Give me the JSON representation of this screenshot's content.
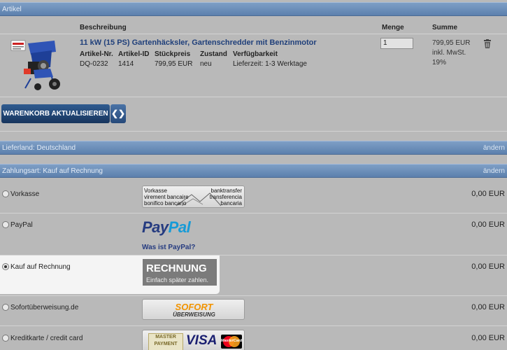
{
  "artikel_bar": {
    "label": "Artikel"
  },
  "table_headers": {
    "beschreibung": "Beschreibung",
    "menge": "Menge",
    "summe": "Summe"
  },
  "product": {
    "title": "11 kW (15 PS) Gartenhäcksler, Gartenschredder mit Benzinmotor",
    "artikel_nr_label": "Artikel-Nr.",
    "artikel_nr": "DQ-0232",
    "artikel_id_label": "Artikel-ID",
    "artikel_id": "1414",
    "stueckpreis_label": "Stückpreis",
    "stueckpreis": "799,95 EUR",
    "zustand_label": "Zustand",
    "zustand": "neu",
    "verfuegbarkeit_label": "Verfügbarkeit",
    "verfuegbarkeit": "Lieferzeit: 1-3 Werktage",
    "quantity": "1",
    "sum_price": "799,95 EUR",
    "sum_tax": "inkl. MwSt.",
    "sum_rate": "19%",
    "icons": {
      "image": "garden-shredder-image",
      "delete": "trash-icon"
    }
  },
  "cart": {
    "update_label": "WARENKORB AKTUALISIEREN",
    "arrow_label": "❮❯"
  },
  "lieferland_bar": {
    "label": "Lieferland: Deutschland",
    "change": "ändern"
  },
  "zahlungsart_bar": {
    "label": "Zahlungsart: Kauf auf Rechnung",
    "change": "ändern"
  },
  "payment_methods": [
    {
      "name": "Vorkasse",
      "price": "0,00 EUR",
      "selected": false,
      "logo_lines_left": [
        "Vorkasse",
        "virement bancaire",
        "bonifico bancario"
      ],
      "logo_lines_right": [
        "banktransfer",
        "transferencia",
        "bancaria"
      ]
    },
    {
      "name": "PayPal",
      "price": "0,00 EUR",
      "selected": false,
      "logo_pay": "Pay",
      "logo_pal": "Pal",
      "link": "Was ist PayPal?"
    },
    {
      "name": "Kauf auf Rechnung",
      "price": "0,00 EUR",
      "selected": true,
      "logo_main": "RECHNUNG",
      "logo_sub": "Einfach später zahlen."
    },
    {
      "name": "Sofortüberweisung.de",
      "price": "0,00 EUR",
      "selected": false,
      "logo_main": "SOFORT",
      "logo_sub": "ÜBERWEISUNG"
    },
    {
      "name": "Kreditkarte / credit card",
      "price": "0,00 EUR",
      "selected": false,
      "logo_master_top": "MASTER",
      "logo_master_bottom": "PAYMENT",
      "logo_visa": "VISA",
      "logo_mc": "MasterCard"
    }
  ],
  "colors": {
    "bar": "#5c80ad",
    "button": "#17355d",
    "title": "#1f3f7a",
    "paypal_dark": "#253b80",
    "paypal_light": "#179bd7",
    "sofort": "#f29400"
  }
}
